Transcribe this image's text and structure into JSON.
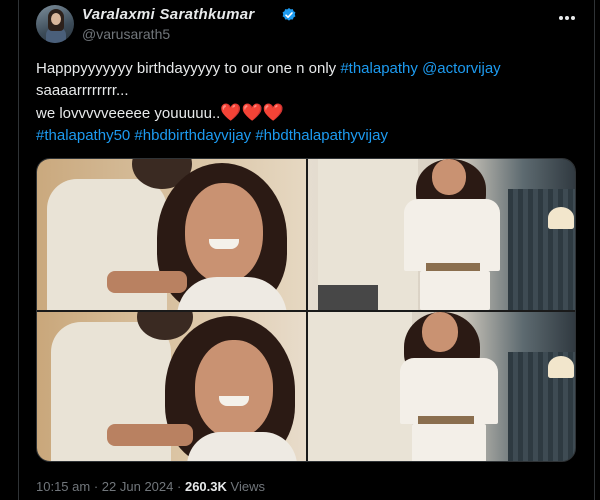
{
  "author": {
    "display_name": "Varalaxmi Sarathkumar",
    "handle": "@varusarath5",
    "verified": true
  },
  "tweet": {
    "line1_text": "Happpyyyyyyy birthdayyyyy to our one n only ",
    "line1_tag1": "#thalapathy",
    "line1_tag2": "@actorvijay",
    "line2_text": "saaaarrrrrrrr...",
    "line3_text": " we lovvvvveeeee youuuuu..",
    "line3_hearts": "❤️❤️❤️",
    "hashtag1": "#thalapathy50",
    "hashtag2": "#hbdbirthdayvijay",
    "hashtag3": "#hbdthalapathyvijay"
  },
  "media": {
    "photo_count": 4
  },
  "footer": {
    "time": "10:15 am",
    "separator": "·",
    "date": "22 Jun 2024",
    "views_count": "260.3K",
    "views_label": "Views"
  },
  "colors": {
    "background": "#000000",
    "text": "#e7e9ea",
    "muted": "#71767b",
    "link": "#1d9bf0",
    "heart": "#f91880",
    "verified": "#1d9bf0"
  },
  "icons": {
    "verified": "verified-badge-icon",
    "more": "more-options-icon"
  }
}
